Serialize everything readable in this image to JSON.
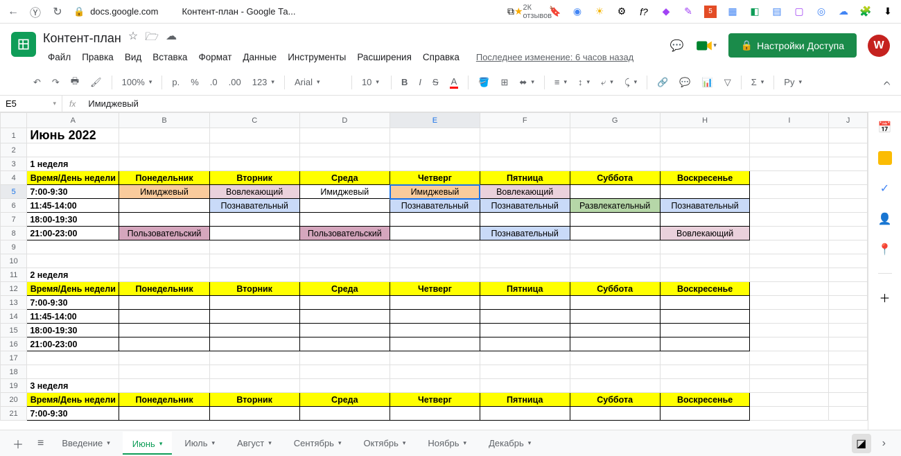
{
  "browser": {
    "domain": "docs.google.com",
    "tab_title": "Контент-план - Google Та...",
    "reviews": "2К отзывов"
  },
  "doc": {
    "title": "Контент-план",
    "last_edit": "Последнее изменение: 6 часов назад",
    "share_label": "Настройки Доступа",
    "avatar_letter": "W"
  },
  "menu": [
    "Файл",
    "Правка",
    "Вид",
    "Вставка",
    "Формат",
    "Данные",
    "Инструменты",
    "Расширения",
    "Справка"
  ],
  "toolbar": {
    "zoom": "100%",
    "currency": "р.",
    "font": "Arial",
    "size": "10",
    "sigma": "Σ",
    "lang": "Ру"
  },
  "formula": {
    "cell": "E5",
    "value": "Имиджевый"
  },
  "columns": [
    "A",
    "B",
    "C",
    "D",
    "E",
    "F",
    "G",
    "H",
    "I",
    "J"
  ],
  "col_widths": [
    "colA",
    "colB",
    "colC",
    "colD",
    "colE",
    "colF",
    "colG",
    "colH",
    "colI",
    "colJ"
  ],
  "sheet": {
    "title": "Июнь 2022",
    "week1": "1 неделя",
    "week2": "2 неделя",
    "week3": "3 неделя",
    "header_row": [
      "Время/День недели",
      "Понедельник",
      "Вторник",
      "Среда",
      "Четверг",
      "Пятница",
      "Суббота",
      "Воскресенье"
    ],
    "times": [
      "7:00-9:30",
      "11:45-14:00",
      "18:00-19:30",
      "21:00-23:00"
    ],
    "w1": {
      "r1": [
        {
          "t": "Имиджевый",
          "c": "bg-peach"
        },
        {
          "t": "Вовлекающий",
          "c": "bg-pink"
        },
        {
          "t": "Имиджевый",
          "c": ""
        },
        {
          "t": "Имиджевый",
          "c": "bg-peach"
        },
        {
          "t": "Вовлекающий",
          "c": "bg-pink"
        },
        {
          "t": "",
          "c": ""
        },
        {
          "t": "",
          "c": ""
        }
      ],
      "r2": [
        {
          "t": "",
          "c": ""
        },
        {
          "t": "Познавательный",
          "c": "bg-blue"
        },
        {
          "t": "",
          "c": ""
        },
        {
          "t": "Познавательный",
          "c": "bg-blue"
        },
        {
          "t": "Познавательный",
          "c": "bg-blue"
        },
        {
          "t": "Развлекательный",
          "c": "bg-green"
        },
        {
          "t": "Познавательный",
          "c": "bg-blue"
        }
      ],
      "r3": [
        {
          "t": "",
          "c": ""
        },
        {
          "t": "",
          "c": ""
        },
        {
          "t": "",
          "c": ""
        },
        {
          "t": "",
          "c": ""
        },
        {
          "t": "",
          "c": ""
        },
        {
          "t": "",
          "c": ""
        },
        {
          "t": "",
          "c": ""
        }
      ],
      "r4": [
        {
          "t": "Пользовательский",
          "c": "bg-rose"
        },
        {
          "t": "",
          "c": ""
        },
        {
          "t": "Пользовательский",
          "c": "bg-rose"
        },
        {
          "t": "",
          "c": ""
        },
        {
          "t": "Познавательный",
          "c": "bg-blue"
        },
        {
          "t": "",
          "c": ""
        },
        {
          "t": "Вовлекающий",
          "c": "bg-pink"
        }
      ]
    }
  },
  "tabs": [
    "Введение",
    "Июнь",
    "Июль",
    "Август",
    "Сентябрь",
    "Октябрь",
    "Ноябрь",
    "Декабрь"
  ],
  "active_tab": 1
}
